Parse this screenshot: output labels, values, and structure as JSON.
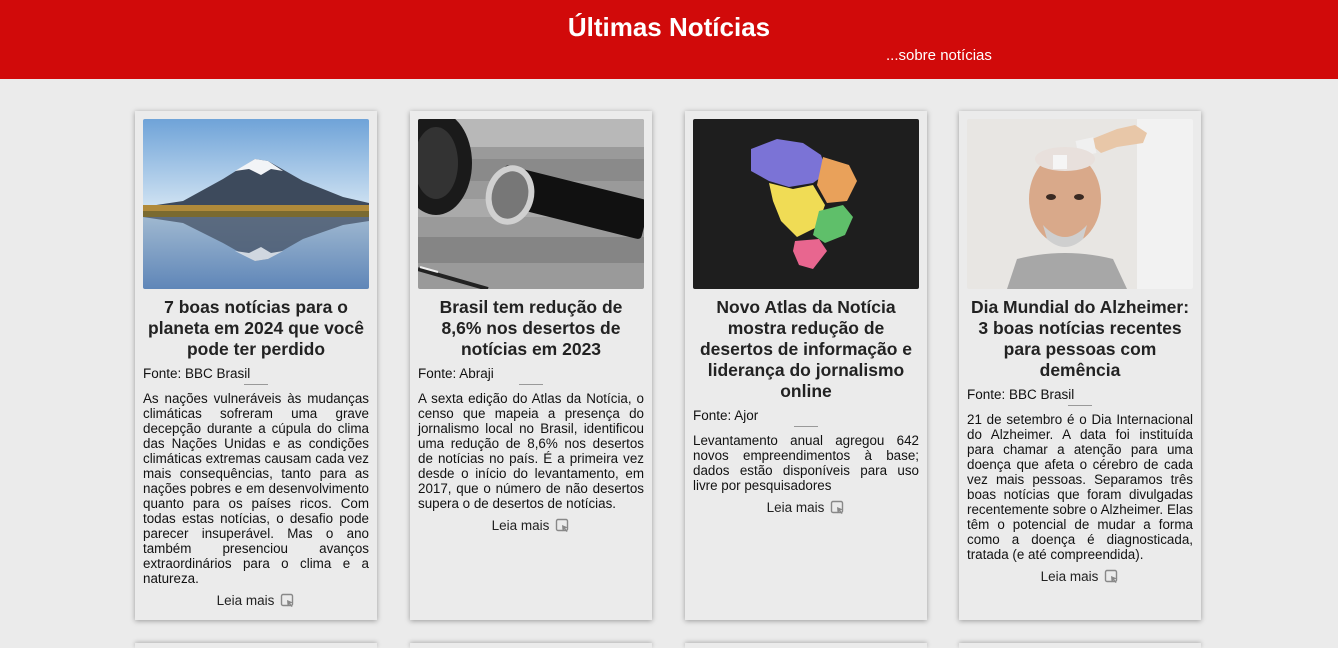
{
  "header": {
    "title": "Últimas Notícias",
    "subtitle": "...sobre notícias",
    "background_color": "#d10a0a"
  },
  "cards": [
    {
      "title": "7 boas notícias para o planeta em 2024 que você pode ter perdido",
      "source": "Fonte: BBC Brasil",
      "description": "As nações vulneráveis às mudanças climáticas sofreram uma grave decepção durante a cúpula do clima das Nações Unidas e as condições climáticas extremas causam cada vez mais consequências, tanto para as nações pobres e em desenvolvimento quanto para os países ricos. Com todas estas notícias, o desafio pode parecer insuperável. Mas o ano também presenciou avanços extraordinários para o clima e a natureza.",
      "read_more": "Leia mais",
      "image": "mountain-lake-photo"
    },
    {
      "title": "Brasil tem redução de 8,6% nos desertos de notícias em 2023",
      "source": "Fonte: Abraji",
      "description": "A sexta edição do Atlas da Notícia, o censo que mapeia a presença do jornalismo local no Brasil, identificou uma redução de 8,6% nos desertos de notícias no país. É a primeira vez desde o início do levantamento, em 2017, que o número de não desertos supera o de desertos de notícias.",
      "read_more": "Leia mais",
      "image": "microphone-photo"
    },
    {
      "title": "Novo Atlas da Notícia mostra redução de desertos de informação e liderança do jornalismo online",
      "source": "Fonte: Ajor",
      "description": "Levantamento anual agregou 642 novos empreendimentos à base; dados estão disponíveis para uso livre por pesquisadores",
      "read_more": "Leia mais",
      "image": "brazil-map-illustration"
    },
    {
      "title": "Dia Mundial do Alzheimer: 3 boas notícias recentes para pessoas com demência",
      "source": "Fonte: BBC Brasil",
      "description": "21 de setembro é o Dia Internacional do Alzheimer. A data foi instituída para chamar a atenção para uma doença que afeta o cérebro de cada vez mais pessoas. Separamos três boas notícias que foram divulgadas recentemente sobre o Alzheimer. Elas têm o potencial de mudar a forma como a doença é diagnosticada, tratada (e até compreendida).",
      "read_more": "Leia mais",
      "image": "elderly-man-puzzle-photo"
    }
  ]
}
